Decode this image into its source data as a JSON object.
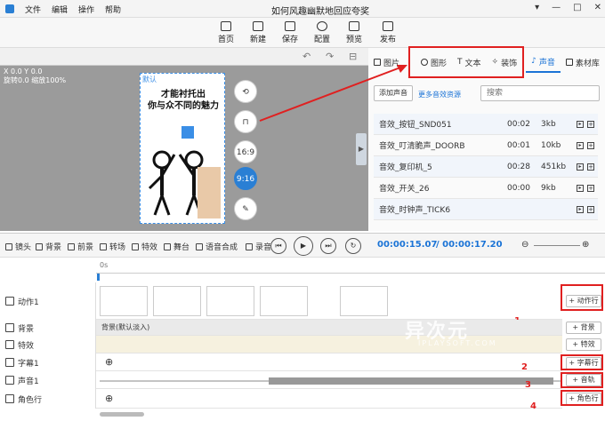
{
  "menu": [
    "文件",
    "编辑",
    "操作",
    "帮助"
  ],
  "window_title": "如何风趣幽默地回应夸奖",
  "window_controls": [
    "▾",
    "—",
    "□",
    "✕"
  ],
  "toolbar": [
    {
      "label": "首页",
      "icon": "home-icon"
    },
    {
      "label": "新建",
      "icon": "new-icon"
    },
    {
      "label": "保存",
      "icon": "save-icon"
    },
    {
      "label": "配置",
      "icon": "settings-icon"
    },
    {
      "label": "预览",
      "icon": "preview-icon"
    },
    {
      "label": "发布",
      "icon": "publish-icon"
    }
  ],
  "stage": {
    "coords": "X 0.0 Y 0.0",
    "rotate_zoom": "旋转0.0 缩放100%",
    "tag": "默认",
    "line1": "才能衬托出",
    "line2": "你与众不同的魅力",
    "ratio_169": "16:9",
    "ratio_916": "9:16"
  },
  "right_tabs": [
    {
      "label": "图片",
      "active": false
    },
    {
      "label": "图形",
      "active": false
    },
    {
      "label": "文本",
      "active": false
    },
    {
      "label": "装饰",
      "active": false
    },
    {
      "label": "声音",
      "active": true
    },
    {
      "label": "素材库",
      "active": false
    }
  ],
  "sound_panel": {
    "add_label": "添加声音",
    "more_label": "更多音效资源",
    "search_placeholder": "搜索",
    "items": [
      {
        "name": "音效_按钮_SND051",
        "duration": "00:02",
        "size": "3kb"
      },
      {
        "name": "音效_叮清脆声_DOORB",
        "duration": "00:01",
        "size": "10kb"
      },
      {
        "name": "音效_复印机_5",
        "duration": "00:28",
        "size": "451kb"
      },
      {
        "name": "音效_开关_26",
        "duration": "00:00",
        "size": "9kb"
      },
      {
        "name": "音效_时钟声_TICK6",
        "duration": "",
        "size": ""
      }
    ]
  },
  "lower_toolbar": [
    "镜头",
    "背景",
    "前景",
    "转场",
    "特效",
    "舞台",
    "语音合成",
    "录音"
  ],
  "timecode_current": "00:00:15.07",
  "timecode_total": "/ 00:00:17.20",
  "ruler_start": "0s",
  "rows": [
    {
      "label": "动作1",
      "add": "+ 动作行",
      "marker": "1"
    },
    {
      "label": "背景",
      "add": "+ 背景",
      "track_text": "背景(默认淡入)"
    },
    {
      "label": "特效",
      "add": "+ 特效"
    },
    {
      "label": "字幕1",
      "add": "+ 字幕行",
      "marker": "2"
    },
    {
      "label": "声音1",
      "add": "+ 音轨",
      "marker": "3"
    },
    {
      "label": "角色行",
      "add": "+ 角色行",
      "marker": "4"
    }
  ],
  "watermark": "异次元",
  "watermark_sub": "IPLAYSOFT.COM",
  "colors": {
    "accent": "#1a73d6",
    "annotation": "#e02020"
  }
}
